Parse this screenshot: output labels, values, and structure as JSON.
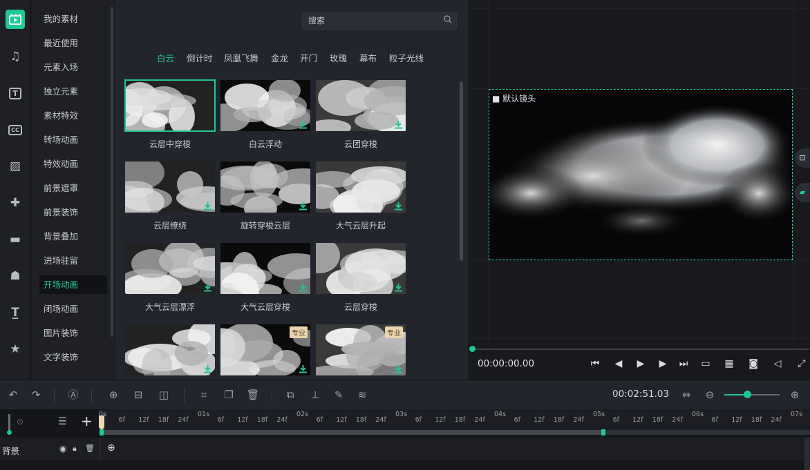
{
  "rail": {
    "icons": [
      "media-icon",
      "music-icon",
      "text-icon",
      "caption-icon",
      "filter-icon",
      "element-icon",
      "folder-icon",
      "character-icon",
      "text-style-icon",
      "star-icon"
    ]
  },
  "categories": [
    "我的素材",
    "最近使用",
    "元素入场",
    "独立元素",
    "素材特效",
    "转场动画",
    "特效动画",
    "前景遮罩",
    "前景装饰",
    "背景叠加",
    "进场驻留",
    "开场动画",
    "闭场动画",
    "图片装饰",
    "文字装饰"
  ],
  "active_category": "开场动画",
  "search": {
    "placeholder": "搜索"
  },
  "tabs": [
    "白云",
    "倒计时",
    "凤凰飞舞",
    "金龙",
    "开门",
    "玫瑰",
    "幕布",
    "粒子光线"
  ],
  "active_tab": "白云",
  "items": [
    {
      "label": "云层中穿梭",
      "download": false,
      "pro": ""
    },
    {
      "label": "白云浮动",
      "download": true,
      "pro": ""
    },
    {
      "label": "云团穿梭",
      "download": true,
      "pro": ""
    },
    {
      "label": "云层缭绕",
      "download": true,
      "pro": ""
    },
    {
      "label": "旋转穿梭云层",
      "download": true,
      "pro": ""
    },
    {
      "label": "大气云层升起",
      "download": true,
      "pro": ""
    },
    {
      "label": "大气云层漂浮",
      "download": true,
      "pro": ""
    },
    {
      "label": "大气云层穿梭",
      "download": true,
      "pro": ""
    },
    {
      "label": "云层穿梭",
      "download": true,
      "pro": ""
    },
    {
      "label": "",
      "download": true,
      "pro": ""
    },
    {
      "label": "",
      "download": true,
      "pro": "专业"
    },
    {
      "label": "",
      "download": true,
      "pro": "专业"
    }
  ],
  "preview": {
    "camera_label": "默认镜头",
    "current_time": "00:00:00.00"
  },
  "timeline": {
    "total_time": "00:02:51.03",
    "zoom_level": 0.41,
    "ruler": [
      "0s",
      "6f",
      "12f",
      "18f",
      "24f",
      "01s",
      "6f",
      "12f",
      "18f",
      "24f",
      "02s",
      "6f",
      "12f",
      "18f",
      "24f",
      "03s",
      "6f",
      "12f",
      "18f",
      "24f",
      "04s",
      "6f",
      "12f",
      "18f",
      "24f",
      "05s",
      "6f",
      "12f",
      "18f",
      "24f",
      "06s",
      "6f",
      "12f",
      "18f",
      "24f",
      "07s"
    ],
    "track_label": "背景"
  },
  "colors": {
    "accent": "#1fc796",
    "panel": "#22252b",
    "rail": "#1e2026"
  }
}
